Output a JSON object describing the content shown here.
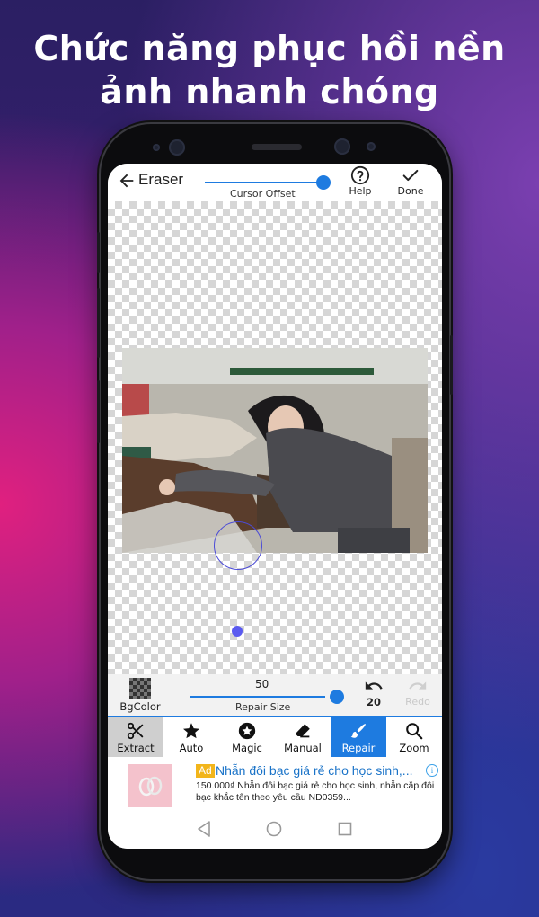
{
  "promo": {
    "headline": "Chức năng phục hồi nền ảnh nhanh chóng"
  },
  "topbar": {
    "title": "Eraser",
    "offset_label": "Cursor Offset",
    "help_label": "Help",
    "done_label": "Done",
    "accent_color": "#1e7be0"
  },
  "controls": {
    "bgcolor_label": "BgColor",
    "size_value": "50",
    "size_label": "Repair Size",
    "undo_count": "20",
    "redo_label": "Redo"
  },
  "tools": [
    {
      "label": "Extract",
      "icon": "scissors-icon"
    },
    {
      "label": "Auto",
      "icon": "star-icon"
    },
    {
      "label": "Magic",
      "icon": "magic-star-icon"
    },
    {
      "label": "Manual",
      "icon": "eraser-icon"
    },
    {
      "label": "Repair",
      "icon": "brush-icon",
      "active": true
    },
    {
      "label": "Zoom",
      "icon": "search-icon"
    }
  ],
  "ad": {
    "badge": "Ad",
    "title": "Nhẫn đôi bạc giá rẻ cho học sinh,...",
    "description": "150.000₫ Nhẫn đôi bạc giá rẻ cho học sinh, nhẫn cặp đôi bạc khắc tên theo yêu cầu ND0359..."
  }
}
